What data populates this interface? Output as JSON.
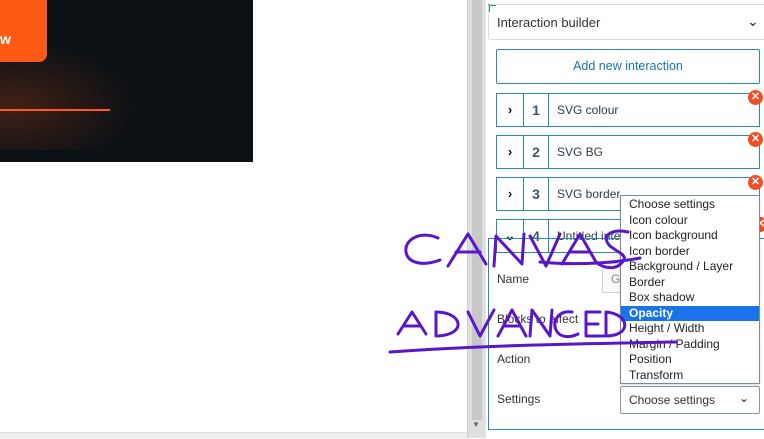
{
  "preview": {
    "button_text": "w"
  },
  "panel": {
    "header_title": "Interaction builder",
    "add_button": "Add new interaction",
    "interactions": [
      {
        "num": "1",
        "label": "SVG colour"
      },
      {
        "num": "2",
        "label": "SVG BG"
      },
      {
        "num": "3",
        "label": "SVG border"
      },
      {
        "num": "4",
        "label": "Untitled inte"
      }
    ],
    "fields": {
      "name_label": "Name",
      "name_value": "G",
      "blocks_label": "Blocks to affect",
      "action_label": "Action",
      "settings_label": "Settings",
      "settings_value": "Choose settings"
    },
    "dropdown_options": [
      "Choose settings",
      "Icon colour",
      "Icon background",
      "Icon border",
      "Background / Layer",
      "Border",
      "Box shadow",
      "Opacity",
      "Height / Width",
      "Margin / Padding",
      "Position",
      "Transform"
    ],
    "dropdown_selected": "Opacity"
  },
  "annotations": {
    "word1": "CANVAS",
    "word2": "ADVANCED"
  },
  "colors": {
    "accent": "#ff5a14",
    "border_blue": "#2b8ab3",
    "remove_red": "#f04e23",
    "selected_bg": "#1a73e8",
    "ink": "#5a17c7"
  }
}
